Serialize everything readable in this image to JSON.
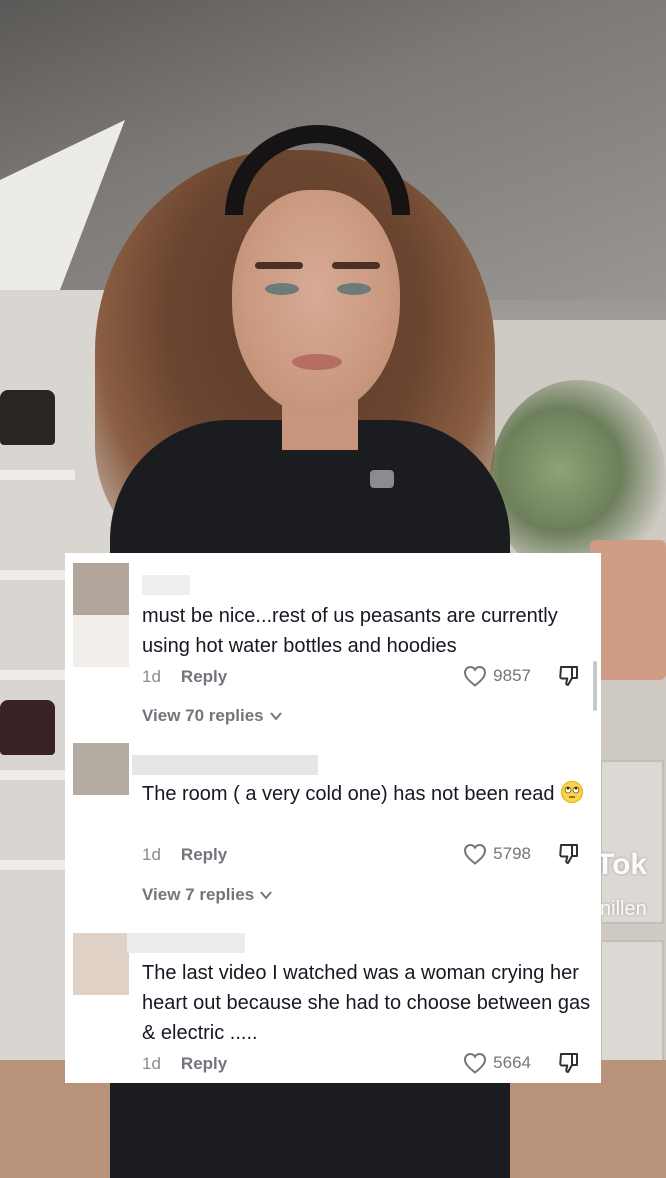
{
  "watermark": {
    "brand": "Tok",
    "username": "nillen"
  },
  "comments": [
    {
      "text": "must be nice...rest of us peasants are currently using hot water bottles and hoodies",
      "age": "1d",
      "reply_label": "Reply",
      "likes": "9857",
      "view_replies": "View 70 replies"
    },
    {
      "text": "The room ( a very cold one) has not been read",
      "age": "1d",
      "reply_label": "Reply",
      "likes": "5798",
      "view_replies": "View 7 replies"
    },
    {
      "text": "The last video I watched was a woman crying her heart out because she had to choose between gas & electric .....",
      "age": "1d",
      "reply_label": "Reply",
      "likes": "5664"
    }
  ],
  "icons": {
    "like": "heart-outline-icon",
    "dislike": "thumbs-down-outline-icon",
    "expand": "chevron-down-icon",
    "emoji": "rolling-eyes-emoji"
  },
  "colors": {
    "text": "#161823",
    "muted": "#73757c",
    "panel": "#ffffff"
  }
}
